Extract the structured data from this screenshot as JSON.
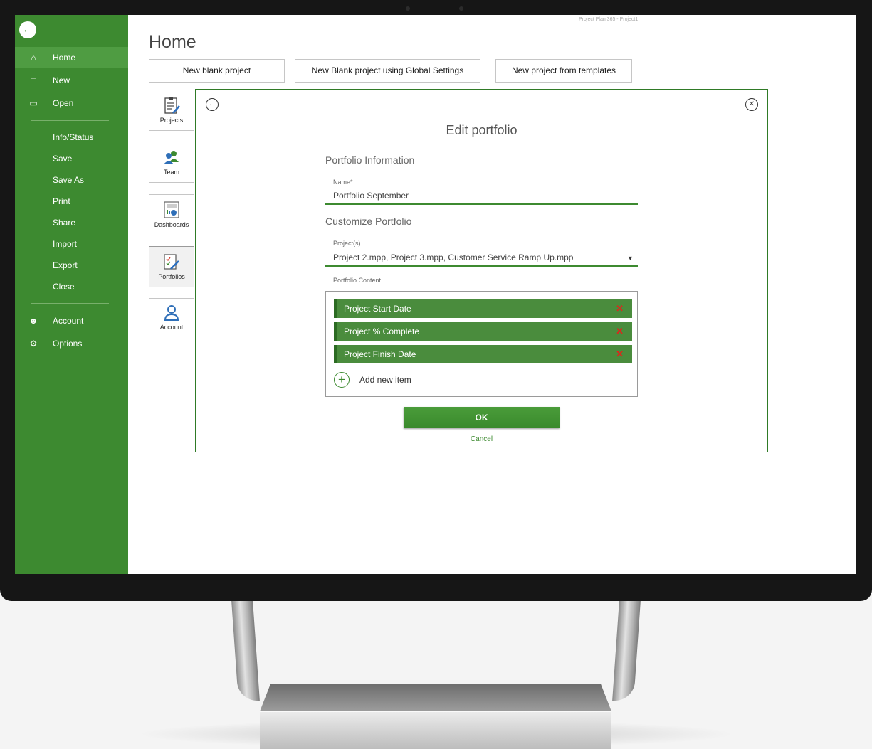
{
  "window_caption": "Project Plan 365 - Project1",
  "sidebar": {
    "nav": [
      {
        "label": "Home",
        "icon": "home-icon"
      },
      {
        "label": "New",
        "icon": "document-icon"
      },
      {
        "label": "Open",
        "icon": "folder-icon"
      }
    ],
    "sub_items": [
      "Info/Status",
      "Save",
      "Save As",
      "Print",
      "Share",
      "Import",
      "Export",
      "Close"
    ],
    "bottom": [
      {
        "label": "Account",
        "icon": "person-icon"
      },
      {
        "label": "Options",
        "icon": "gear-icon"
      }
    ],
    "active": "Home"
  },
  "home": {
    "title": "Home",
    "buttons": [
      "New blank project",
      "New Blank project using Global Settings",
      "New project from templates"
    ],
    "tiles": [
      "Projects",
      "Team",
      "Dashboards",
      "Portfolios",
      "Account"
    ],
    "active_tile": "Portfolios"
  },
  "dialog": {
    "title": "Edit portfolio",
    "portfolio_info_title": "Portfolio Information",
    "name_label": "Name*",
    "name_value": "Portfolio September",
    "customize_title": "Customize Portfolio",
    "projects_label": "Project(s)",
    "projects_value": "Project 2.mpp, Project 3.mpp, Customer Service Ramp Up.mpp",
    "content_label": "Portfolio Content",
    "content_items": [
      "Project Start Date",
      "Project % Complete",
      "Project Finish Date"
    ],
    "remove_glyph": "✕",
    "add_label": "Add new item",
    "ok_label": "OK",
    "cancel_label": "Cancel"
  },
  "colors": {
    "brand_green": "#3d8a30",
    "remove_red": "#e0241b"
  }
}
